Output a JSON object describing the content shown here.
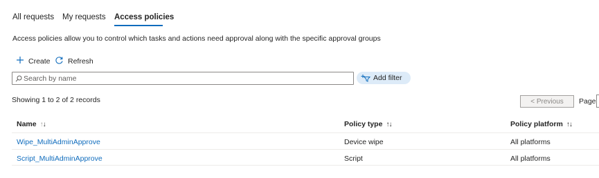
{
  "tabs": [
    {
      "label": "All requests",
      "active": false
    },
    {
      "label": "My requests",
      "active": false
    },
    {
      "label": "Access policies",
      "active": true
    }
  ],
  "description": "Access policies allow you to control which tasks and actions need approval along with the specific approval groups",
  "toolbar": {
    "create_label": "Create",
    "refresh_label": "Refresh",
    "create_icon": "plus-icon",
    "refresh_icon": "refresh-icon"
  },
  "search": {
    "placeholder": "Search by name",
    "value": "",
    "icon": "search-icon"
  },
  "filter": {
    "label": "Add filter",
    "icon": "add-filter-icon"
  },
  "pagination": {
    "records_text": "Showing 1 to 2 of 2 records",
    "previous_label": "< Previous",
    "page_label": "Page"
  },
  "table": {
    "columns": [
      "Name",
      "Policy type",
      "Policy platform"
    ],
    "rows": [
      {
        "name": "Wipe_MultiAdminApprove",
        "policy_type": "Device wipe",
        "policy_platform": "All platforms"
      },
      {
        "name": "Script_MultiAdminApprove",
        "policy_type": "Script",
        "policy_platform": "All platforms"
      }
    ]
  },
  "colors": {
    "accent": "#0f6cbd",
    "filter_pill": "#ddebf8",
    "text": "#242424"
  }
}
